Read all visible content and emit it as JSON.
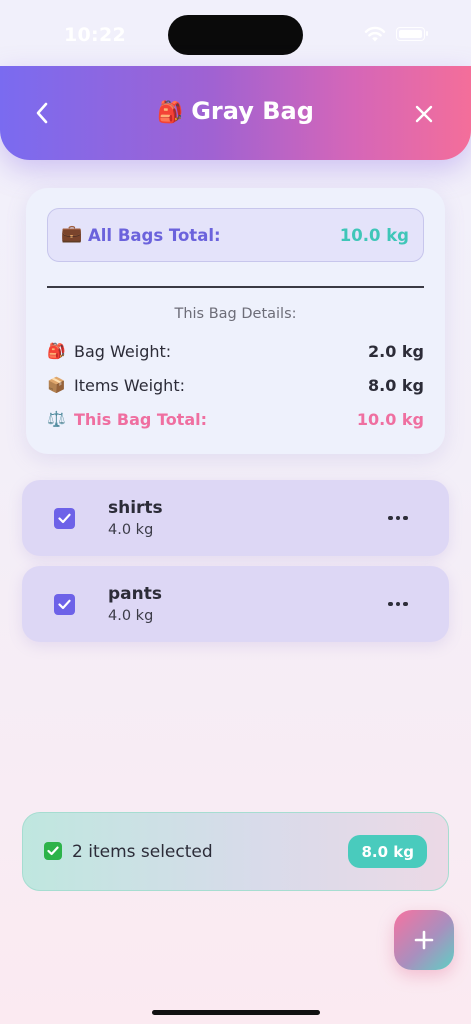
{
  "status_bar": {
    "time": "10:22"
  },
  "header": {
    "title_emoji": "🎒",
    "title": "Gray Bag"
  },
  "summary": {
    "all_bags": {
      "icon": "💼",
      "label": "All Bags Total:",
      "value": "10.0 kg"
    },
    "details_heading": "This Bag Details:",
    "rows": [
      {
        "icon": "🎒",
        "label": "Bag Weight:",
        "value": "2.0 kg"
      },
      {
        "icon": "📦",
        "label": "Items Weight:",
        "value": "8.0 kg"
      },
      {
        "icon": "⚖️",
        "label": "This Bag Total:",
        "value": "10.0 kg"
      }
    ]
  },
  "items": [
    {
      "name": "shirts",
      "weight": "4.0 kg",
      "checked": true
    },
    {
      "name": "pants",
      "weight": "4.0 kg",
      "checked": true
    }
  ],
  "selection": {
    "text": "2 items selected",
    "total": "8.0 kg"
  },
  "colors": {
    "accent": "#6d62e8",
    "teal": "#49cbbd",
    "pink": "#ef6fa0"
  },
  "icons": {
    "back": "chevron-left-icon",
    "close": "close-icon",
    "more": "more-horizontal-icon",
    "add": "plus-icon",
    "selected": "check-square-icon"
  }
}
